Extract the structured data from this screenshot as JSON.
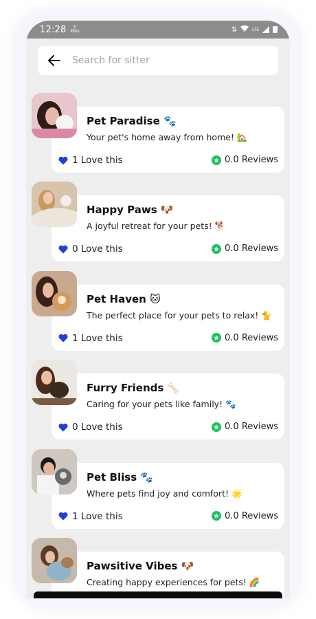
{
  "status_bar": {
    "time": "12:28",
    "net_speed": "0",
    "net_unit": "KB/s",
    "network": "LTE"
  },
  "search": {
    "placeholder": "Search for sitter",
    "value": ""
  },
  "sitters": [
    {
      "name": "Pet Paradise 🐾",
      "tagline": "Your pet's home away from home! 🏡",
      "loves": "1 Love this",
      "reviews": "0.0 Reviews",
      "photo_tone": "#e7c7c9"
    },
    {
      "name": "Happy Paws 🐶",
      "tagline": "A joyful retreat for your pets! 🐕",
      "loves": "0 Love this",
      "reviews": "0.0 Reviews",
      "photo_tone": "#d8c3ac"
    },
    {
      "name": "Pet Haven 🐱",
      "tagline": "The perfect place for your pets to relax! 🐈",
      "loves": "1 Love this",
      "reviews": "0.0 Reviews",
      "photo_tone": "#c9a98d"
    },
    {
      "name": "Furry Friends 🦴",
      "tagline": "Caring for your pets like family! 🐾",
      "loves": "0 Love this",
      "reviews": "0.0 Reviews",
      "photo_tone": "#d4c2b3"
    },
    {
      "name": "Pet Bliss 🐾",
      "tagline": "Where pets find joy and comfort! 🌟",
      "loves": "1 Love this",
      "reviews": "0.0 Reviews",
      "photo_tone": "#cfc8c0"
    },
    {
      "name": "Pawsitive Vibes 🐶",
      "tagline": "Creating happy experiences for pets! 🌈",
      "loves": "",
      "reviews": "",
      "photo_tone": "#c6b8aa"
    }
  ],
  "colors": {
    "heart": "#1f3fe0",
    "star": "#19c25a",
    "background": "#eeeeee",
    "card": "#ffffff"
  }
}
